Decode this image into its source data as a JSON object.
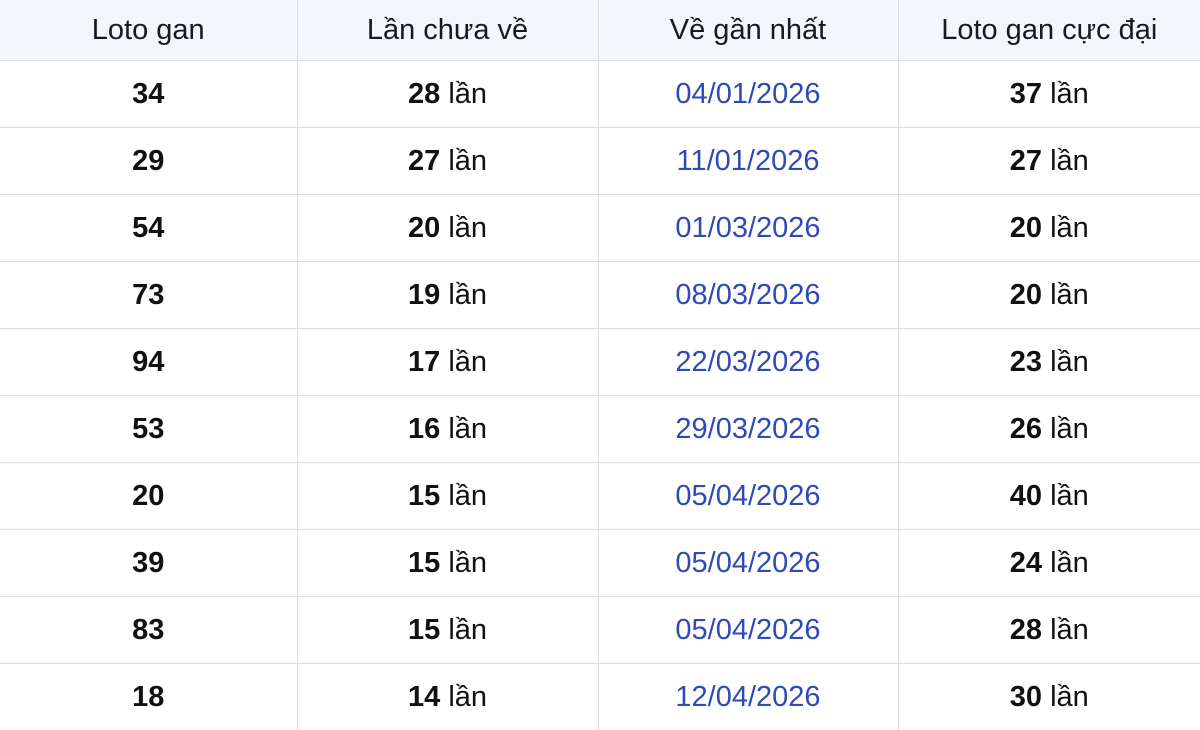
{
  "headers": [
    "Loto gan",
    "Lần chưa về",
    "Về gần nhất",
    "Loto gan cực đại"
  ],
  "unit": "lần",
  "colors": {
    "header_bg": "#f1f7fd",
    "date_text": "#2f4ab8",
    "border": "#dcdcdc"
  },
  "rows": [
    {
      "loto": "34",
      "missed": "28",
      "last_seen": "04/01/2026",
      "max_gan": "37"
    },
    {
      "loto": "29",
      "missed": "27",
      "last_seen": "11/01/2026",
      "max_gan": "27"
    },
    {
      "loto": "54",
      "missed": "20",
      "last_seen": "01/03/2026",
      "max_gan": "20"
    },
    {
      "loto": "73",
      "missed": "19",
      "last_seen": "08/03/2026",
      "max_gan": "20"
    },
    {
      "loto": "94",
      "missed": "17",
      "last_seen": "22/03/2026",
      "max_gan": "23"
    },
    {
      "loto": "53",
      "missed": "16",
      "last_seen": "29/03/2026",
      "max_gan": "26"
    },
    {
      "loto": "20",
      "missed": "15",
      "last_seen": "05/04/2026",
      "max_gan": "40"
    },
    {
      "loto": "39",
      "missed": "15",
      "last_seen": "05/04/2026",
      "max_gan": "24"
    },
    {
      "loto": "83",
      "missed": "15",
      "last_seen": "05/04/2026",
      "max_gan": "28"
    },
    {
      "loto": "18",
      "missed": "14",
      "last_seen": "12/04/2026",
      "max_gan": "30"
    }
  ]
}
